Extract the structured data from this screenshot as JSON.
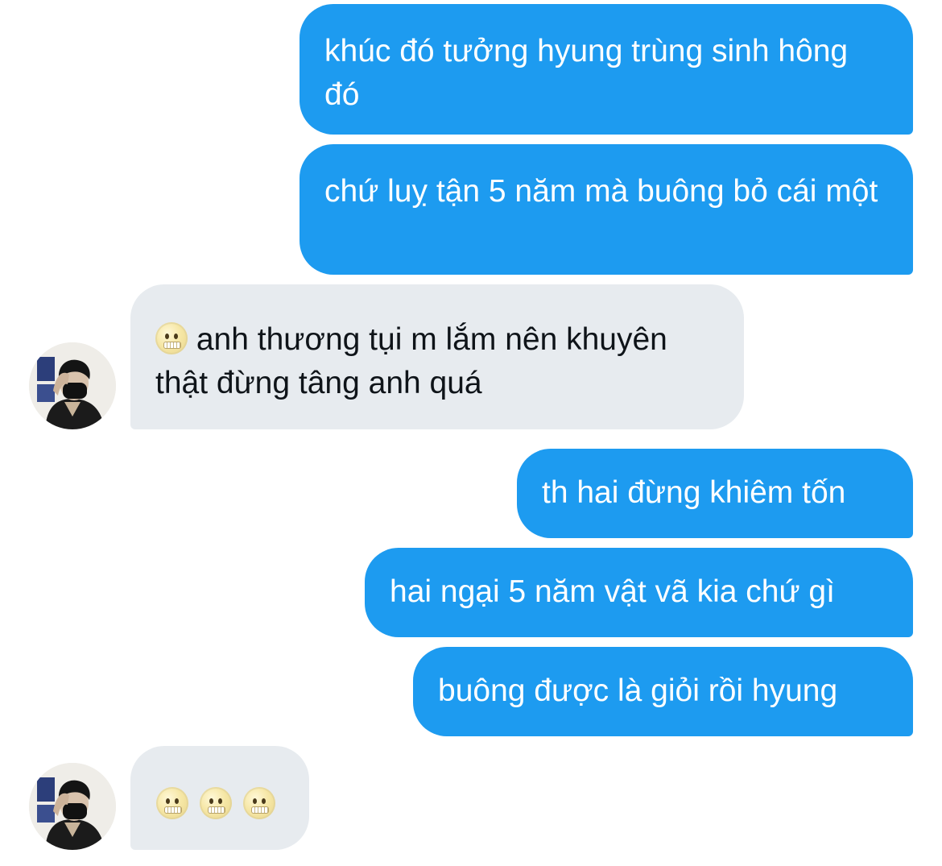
{
  "conversation": {
    "messages": [
      {
        "direction": "outgoing",
        "text": "khúc đó tưởng hyung trùng sinh hông đó"
      },
      {
        "direction": "outgoing",
        "text": "chứ luỵ tận 5 năm mà buông bỏ cái một"
      },
      {
        "direction": "incoming",
        "emoji": "face-with-symbols-on-mouth-icon",
        "text": "anh thương tụi m lắm nên khuyên thật đừng tâng anh quá"
      },
      {
        "direction": "outgoing",
        "text": "th hai đừng khiêm tốn"
      },
      {
        "direction": "outgoing",
        "text": "hai ngại 5 năm vật vã kia chứ gì"
      },
      {
        "direction": "outgoing",
        "text": "buông được là giỏi rồi hyung"
      },
      {
        "direction": "incoming",
        "emoji_only": [
          "grimacing-face-icon",
          "grimacing-face-icon",
          "grimacing-face-icon"
        ]
      }
    ]
  },
  "colors": {
    "outgoing_bubble": "#1d9bf0",
    "incoming_bubble": "#e7ebef",
    "outgoing_text": "#ffffff",
    "incoming_text": "#0f1419"
  }
}
